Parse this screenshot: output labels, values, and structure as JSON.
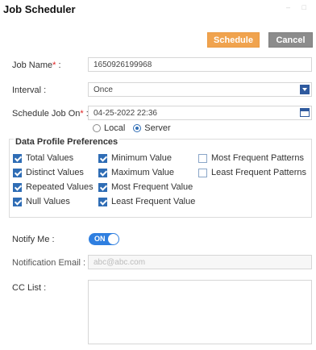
{
  "window": {
    "title": "Job Scheduler",
    "controls": "– □"
  },
  "toolbar": {
    "schedule_label": "Schedule",
    "cancel_label": "Cancel"
  },
  "form": {
    "job_name": {
      "label": "Job Name",
      "required": "*",
      "colon": " :",
      "value": "1650926199968"
    },
    "interval": {
      "label": "Interval :",
      "value": "Once"
    },
    "schedule_on": {
      "label": "Schedule Job On",
      "required": "*",
      "colon": " :",
      "value": "04-25-2022 22:36"
    },
    "timezone": {
      "options": [
        "Local",
        "Server"
      ],
      "selected": "Server"
    }
  },
  "preferences": {
    "legend": "Data Profile Preferences",
    "items": [
      {
        "label": "Total Values",
        "checked": true
      },
      {
        "label": "Distinct Values",
        "checked": true
      },
      {
        "label": "Repeated Values",
        "checked": true
      },
      {
        "label": "Null Values",
        "checked": true
      },
      {
        "label": "Minimum Value",
        "checked": true
      },
      {
        "label": "Maximum Value",
        "checked": true
      },
      {
        "label": "Most Frequent Value",
        "checked": true
      },
      {
        "label": "Least Frequent Value",
        "checked": true
      },
      {
        "label": "Most Frequent Patterns",
        "checked": false
      },
      {
        "label": "Least Frequent Patterns",
        "checked": false
      }
    ]
  },
  "notify": {
    "label": "Notify Me :",
    "toggle_text": "ON",
    "state": "on"
  },
  "email": {
    "label": "Notification Email :",
    "placeholder": "abc@abc.com"
  },
  "cc": {
    "label": "CC List :"
  },
  "colors": {
    "accent": "#f0a34e",
    "secondary": "#8c8c8c",
    "primary": "#2f6db5",
    "toggle": "#2f7fe0"
  }
}
